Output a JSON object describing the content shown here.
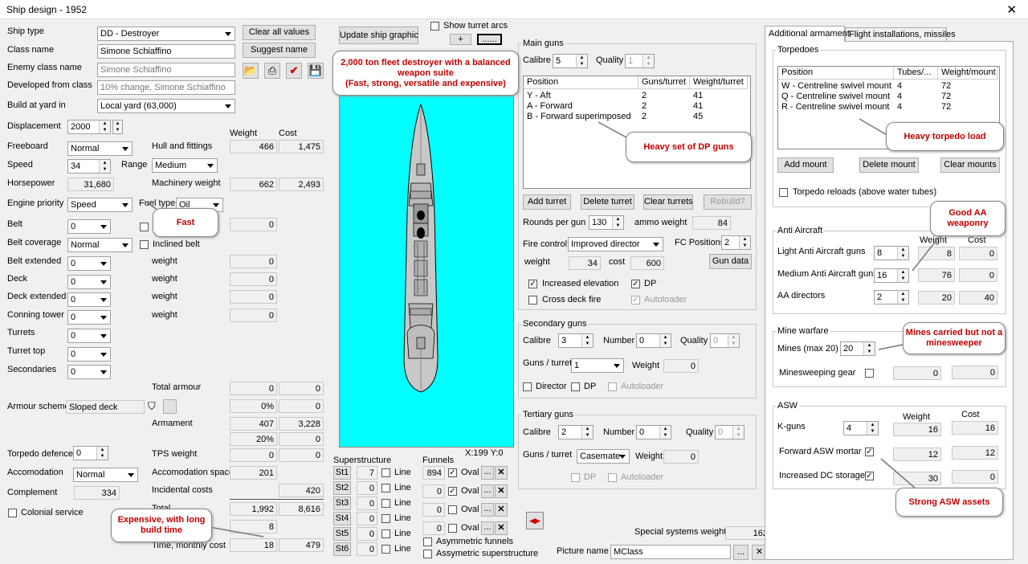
{
  "window": {
    "title": "Ship design - 1952",
    "close": "✕"
  },
  "left": {
    "ship_type_label": "Ship type",
    "ship_type": "DD - Destroyer",
    "class_name_label": "Class name",
    "class_name": "Simone Schiaffino",
    "enemy_class_label": "Enemy class name",
    "enemy_class": "Simone Schiaffino",
    "developed_label": "Developed from class",
    "developed": "10% change, Simone Schiaffino",
    "build_label": "Build at yard in",
    "build": "Local yard (63,000)",
    "clear_btn": "Clear all values",
    "suggest_btn": "Suggest name",
    "displacement_label": "Displacement",
    "displacement": "2000",
    "weight_hdr": "Weight",
    "cost_hdr": "Cost",
    "freeboard_label": "Freeboard",
    "freeboard": "Normal",
    "hull_label": "Hull and fittings",
    "hull_w": "466",
    "hull_c": "1,475",
    "speed_label": "Speed",
    "speed": "34",
    "range_label": "Range",
    "range": "Medium",
    "hp_label": "Horsepower",
    "hp": "31,680",
    "mach_label": "Machinery weight",
    "mach_w": "662",
    "mach_c": "2,493",
    "engine_label": "Engine priority",
    "engine": "Speed",
    "fuel_label": "Fuel type",
    "fuel": "Oil",
    "belt_label": "Belt",
    "belt": "0",
    "belt_w": "0",
    "belt_cov_label": "Belt coverage",
    "belt_cov": "Normal",
    "inclined_label": "Inclined belt",
    "belt_ext_label": "Belt extended",
    "belt_ext": "0",
    "deck_label": "Deck",
    "deck": "0",
    "deck_ext_label": "Deck extended",
    "deck_ext": "0",
    "conning_label": "Conning tower",
    "conning": "0",
    "turrets_label": "Turrets",
    "turrets": "0",
    "turret_top_label": "Turret top",
    "turret_top": "0",
    "secondaries_label": "Secondaries",
    "secondaries": "0",
    "weight_label": "weight",
    "zero": "0",
    "total_armour_label": "Total armour",
    "total_armour_w": "0",
    "total_armour_c": "0",
    "armour_scheme_label": "Armour scheme",
    "armour_scheme": "Sloped deck",
    "pct_w": "0%",
    "pct_c": "0",
    "armament_label": "Armament",
    "armament_w": "407",
    "armament_c": "3,228",
    "pct2_w": "20%",
    "pct2_c": "0",
    "torpedo_def_label": "Torpedo defence",
    "torpedo_def": "0",
    "tps_label": "TPS weight",
    "tps_w": "0",
    "tps_c": "0",
    "accom_label": "Accomodation",
    "accom": "Normal",
    "accom_space_label": "Accomodation space",
    "accom_space": "201",
    "complement_label": "Complement",
    "complement": "334",
    "incidental_label": "Incidental costs",
    "incidental_c": "420",
    "colonial_label": "Colonial service",
    "total_label": "Total",
    "total_w": "1,992",
    "total_c": "8,616",
    "build_time_w": "8",
    "time_cost_label": "Time, monthly cost",
    "time_w": "18",
    "time_c": "479"
  },
  "center": {
    "update_btn": "Update ship graphic",
    "show_arcs": "Show turret arcs",
    "plus": "+",
    "dots": "......",
    "coord": "X:199 Y:0",
    "superstructure_label": "Superstructure",
    "funnels_label": "Funnels",
    "st": [
      {
        "n": "St1",
        "v": "7"
      },
      {
        "n": "St2",
        "v": "0"
      },
      {
        "n": "St3",
        "v": "0"
      },
      {
        "n": "St4",
        "v": "0"
      },
      {
        "n": "St5",
        "v": "0"
      },
      {
        "n": "St6",
        "v": "0"
      }
    ],
    "line": "Line",
    "funnels": [
      {
        "v": "894",
        "c": true
      },
      {
        "v": "0",
        "c": true
      },
      {
        "v": "0",
        "c": false
      },
      {
        "v": "0",
        "c": false
      }
    ],
    "oval": "Oval",
    "ell": "...",
    "x": "✕",
    "asym_funnels": "Asymmetric funnels",
    "asym_super": "Assymetric superstructure"
  },
  "main_guns": {
    "title": "Main guns",
    "calibre_label": "Calibre",
    "calibre": "5",
    "quality_label": "Quality",
    "quality": "1",
    "cols": [
      "Position",
      "Guns/turret",
      "Weight/turret"
    ],
    "rows": [
      [
        "Y - Aft",
        "2",
        "41"
      ],
      [
        "A - Forward",
        "2",
        "41"
      ],
      [
        "B - Forward superimposed",
        "2",
        "45"
      ]
    ],
    "add": "Add turret",
    "delete": "Delete turret",
    "clear": "Clear turrets",
    "rebuild": "Rebuild?",
    "rounds_label": "Rounds per gun",
    "rounds": "130",
    "ammo_label": "ammo weight",
    "ammo": "84",
    "fc_label": "Fire control",
    "fc": "Improved director",
    "fcpos_label": "FC Positions",
    "fcpos": "2",
    "weight_label": "weight",
    "weight": "34",
    "cost_label": "cost",
    "cost": "600",
    "gun_data": "Gun data",
    "inc_elev": "Increased elevation",
    "dp": "DP",
    "cross": "Cross deck fire",
    "autoloader": "Autoloader"
  },
  "secondary": {
    "title": "Secondary guns",
    "calibre_label": "Calibre",
    "calibre": "3",
    "number_label": "Number",
    "number": "0",
    "quality_label": "Quality",
    "quality": "0",
    "gpt_label": "Guns / turret",
    "gpt": "1",
    "weight_label": "Weight",
    "weight": "0",
    "director": "Director",
    "dp": "DP",
    "autoloader": "Autoloader"
  },
  "tertiary": {
    "title": "Tertiary guns",
    "calibre_label": "Calibre",
    "calibre": "2",
    "number_label": "Number",
    "number": "0",
    "quality_label": "Quality",
    "quality": "0",
    "gpt_label": "Guns / turret",
    "gpt": "Casemate",
    "weight_label": "Weight",
    "weight": "0",
    "dp": "DP",
    "autoloader": "Autoloader"
  },
  "bottom": {
    "special_label": "Special systems weight",
    "special": "162",
    "picture_label": "Picture name",
    "picture": "MClass",
    "ell": "...",
    "x": "✕"
  },
  "right": {
    "tab1": "Additional armament",
    "tab2": "Flight installations, missiles",
    "torpedoes_title": "Torpedoes",
    "tcols": [
      "Position",
      "Tubes/...",
      "Weight/mount"
    ],
    "trows": [
      [
        "W - Centreline swivel mount",
        "4",
        "72"
      ],
      [
        "Q - Centreline swivel mount",
        "4",
        "72"
      ],
      [
        "R - Centreline swivel mount",
        "4",
        "72"
      ]
    ],
    "add_mount": "Add mount",
    "delete_mount": "Delete mount",
    "clear_mounts": "Clear mounts",
    "reloads": "Torpedo reloads (above water tubes)",
    "aa_title": "Anti Aircraft",
    "weight_hdr": "Weight",
    "cost_hdr": "Cost",
    "laa_label": "Light Anti Aircraft guns",
    "laa": "8",
    "laa_w": "8",
    "laa_c": "0",
    "maa_label": "Medium Anti Aircraft guns",
    "maa": "16",
    "maa_w": "76",
    "maa_c": "0",
    "aad_label": "AA directors",
    "aad": "2",
    "aad_w": "20",
    "aad_c": "40",
    "mine_title": "Mine warfare",
    "mines_label": "Mines (max 20)",
    "mines": "20",
    "sweep_label": "Minesweeping gear",
    "sweep_w": "0",
    "sweep_c": "0",
    "asw_title": "ASW",
    "kguns_label": "K-guns",
    "kguns": "4",
    "kguns_w": "16",
    "kguns_c": "16",
    "mortar_label": "Forward ASW mortar",
    "mortar_w": "12",
    "mortar_c": "12",
    "dc_label": "Increased DC storage",
    "dc_w": "30",
    "dc_c": "0"
  },
  "callouts": {
    "title": "2,000 ton fleet destroyer with a balanced weapon suite\n(Fast, strong, versatile and expensive)",
    "fast": "Fast",
    "expensive": "Expensive, with long build time",
    "dp": "Heavy set of DP guns",
    "torp": "Heavy torpedo load",
    "aa": "Good AA weaponry",
    "mines": "Mines carried but not a minesweeper",
    "asw": "Strong ASW assets"
  },
  "colors": {
    "titlebar": "#ffffff",
    "canvas": "#00ffff",
    "ship": "#c8c8c8",
    "callout_text": "#c00000",
    "tab_active": "#ffffff"
  }
}
